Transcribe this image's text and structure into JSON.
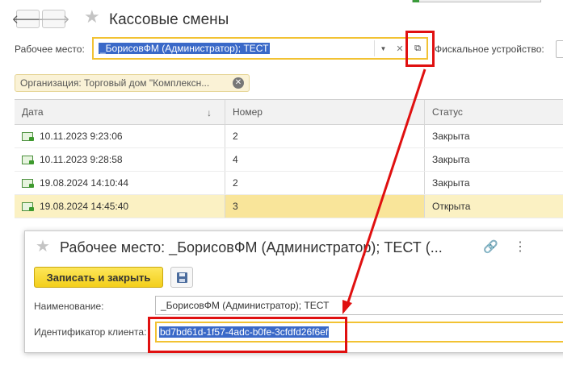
{
  "window": {
    "title": "Кассовые смены",
    "back_glyph": "🡐",
    "forward_glyph": "🡒"
  },
  "filters": {
    "workplace_label": "Рабочее место:",
    "workplace_value": "_БорисовФМ (Администратор); ТЕСТ",
    "fiscal_label": "Фискальное устройство:",
    "organization_tag": "Организация: Торговый дом \"Комплексн..."
  },
  "table": {
    "columns": [
      "Дата",
      "Номер",
      "Статус"
    ],
    "rows": [
      {
        "date": "10.11.2023 9:23:06",
        "number": "2",
        "status": "Закрыта"
      },
      {
        "date": "10.11.2023 9:28:58",
        "number": "4",
        "status": "Закрыта"
      },
      {
        "date": "19.08.2024 14:10:44",
        "number": "2",
        "status": "Закрыта"
      },
      {
        "date": "19.08.2024 14:45:40",
        "number": "3",
        "status": "Открыта"
      }
    ]
  },
  "dialog": {
    "title": "Рабочее место: _БорисовФМ (Администратор); ТЕСТ (...",
    "save_close_label": "Записать и закрыть",
    "name_label": "Наименование:",
    "name_value": "_БорисовФМ (Администратор); ТЕСТ",
    "client_id_label": "Идентификатор клиента:",
    "client_id_value": "bd7bd61d-1f57-4adc-b0fe-3cfdfd26f6ef"
  },
  "colors": {
    "highlight_red": "#e01010",
    "selection_blue": "#3a69c8",
    "accent_yellow": "#f2c233"
  }
}
